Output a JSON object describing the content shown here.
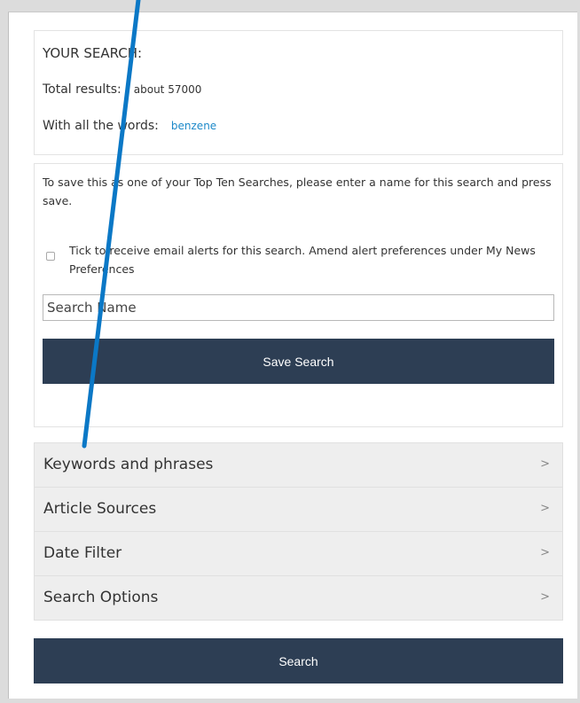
{
  "summary": {
    "heading": "YOUR SEARCH:",
    "total_label": "Total results:",
    "total_value": "about 57000",
    "words_label": "With all the words:",
    "words_value": "benzene"
  },
  "save": {
    "instructions": "To save this as one of your Top Ten Searches, please enter a name for this search and press save.",
    "alert_text": "Tick to receive email alerts for this search. Amend alert preferences under My News Preferences",
    "alert_checked": false,
    "name_placeholder": "Search Name",
    "save_label": "Save Search"
  },
  "accordion": {
    "items": [
      {
        "label": "Keywords and phrases",
        "icon": "chevron-right-icon"
      },
      {
        "label": "Article Sources",
        "icon": "chevron-right-icon"
      },
      {
        "label": "Date Filter",
        "icon": "chevron-right-icon"
      },
      {
        "label": "Search Options",
        "icon": "chevron-right-icon"
      }
    ]
  },
  "search_label": "Search",
  "colors": {
    "button_bg": "#2d3e54",
    "link": "#1d89c9",
    "annotation_line": "#0b78c6"
  }
}
